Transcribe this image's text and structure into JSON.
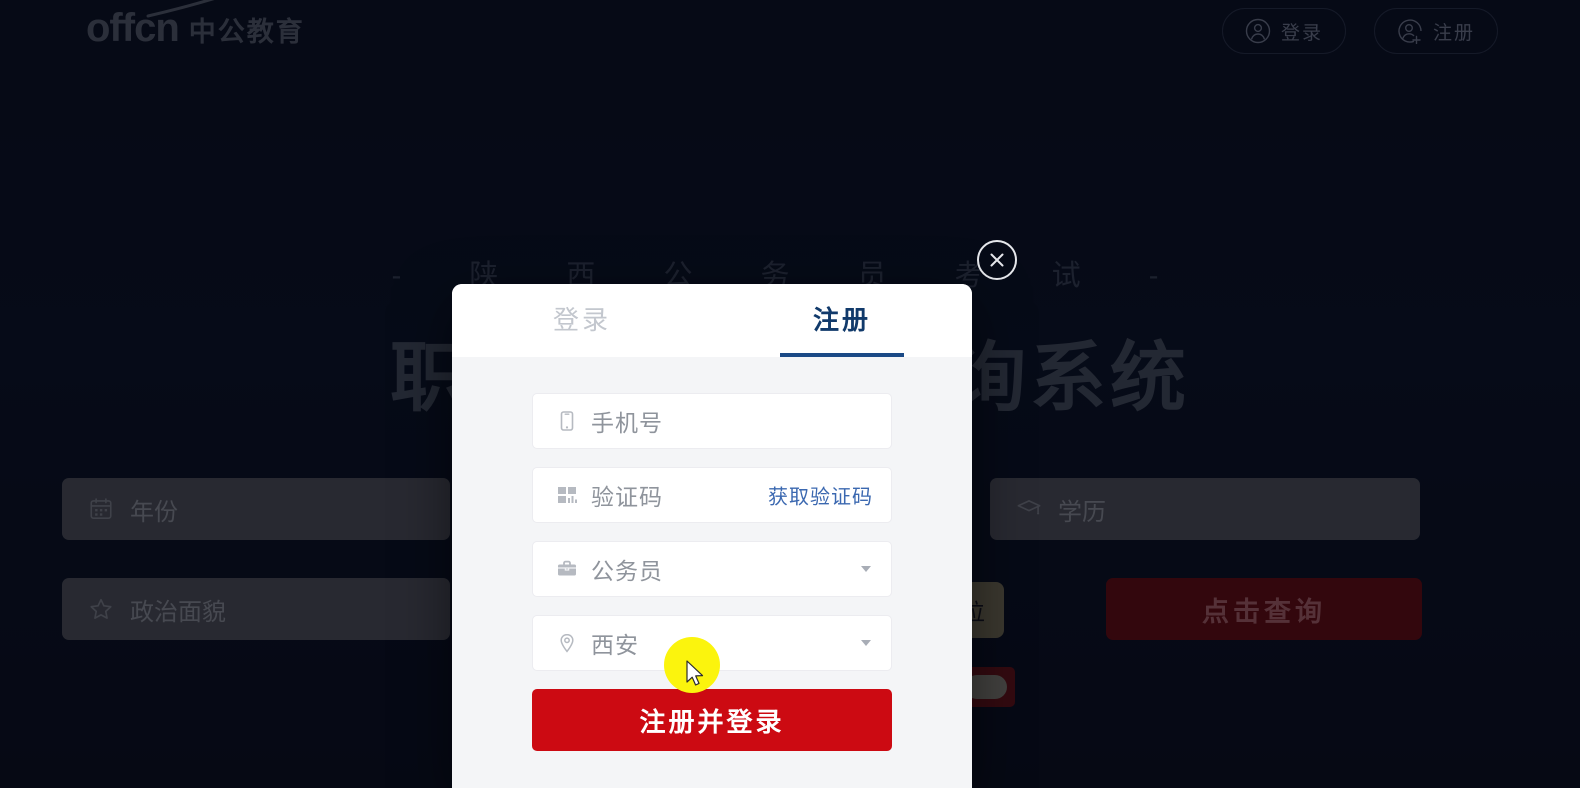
{
  "header": {
    "logo_mark": "offcn",
    "logo_cn": "中公教育",
    "login_button": "登录",
    "register_button": "注册",
    "login_icon": "user-circle-icon",
    "register_icon": "user-plus-circle-icon"
  },
  "hero": {
    "subtitle": "- 陕 西 公 务 员 考 试 -",
    "title": "职位匹配在线查询系统"
  },
  "search": {
    "year_field": "年份",
    "year_icon": "calendar-icon",
    "education_field": "学历",
    "education_icon": "graduation-cap-icon",
    "politics_field": "政治面貌",
    "politics_icon": "star-icon",
    "query_button": "点击查询",
    "tooltip": "求的岗位"
  },
  "modal": {
    "tab_login": "登录",
    "tab_register": "注册",
    "active_tab": "注册",
    "close_icon": "close-circle-icon",
    "fields": [
      {
        "name": "phone",
        "icon": "mobile-phone-icon",
        "placeholder": "手机号",
        "value": "",
        "type": "text"
      },
      {
        "name": "verify-code",
        "icon": "qr-code-icon",
        "placeholder": "验证码",
        "value": "",
        "type": "text",
        "action_label": "获取验证码"
      },
      {
        "name": "exam-type",
        "icon": "briefcase-icon",
        "placeholder": "公务员",
        "value": "公务员",
        "type": "select"
      },
      {
        "name": "city",
        "icon": "location-pin-icon",
        "placeholder": "西安",
        "value": "西安",
        "type": "select"
      }
    ],
    "submit_button": "注册并登录"
  },
  "colors": {
    "accent_red": "#cc0a12",
    "tab_active": "#113a6b",
    "link_blue": "#3b68b0",
    "page_bg": "#0a0f1e",
    "modal_bg": "#f4f5f7",
    "cursor_highlight": "#fbf40d"
  }
}
